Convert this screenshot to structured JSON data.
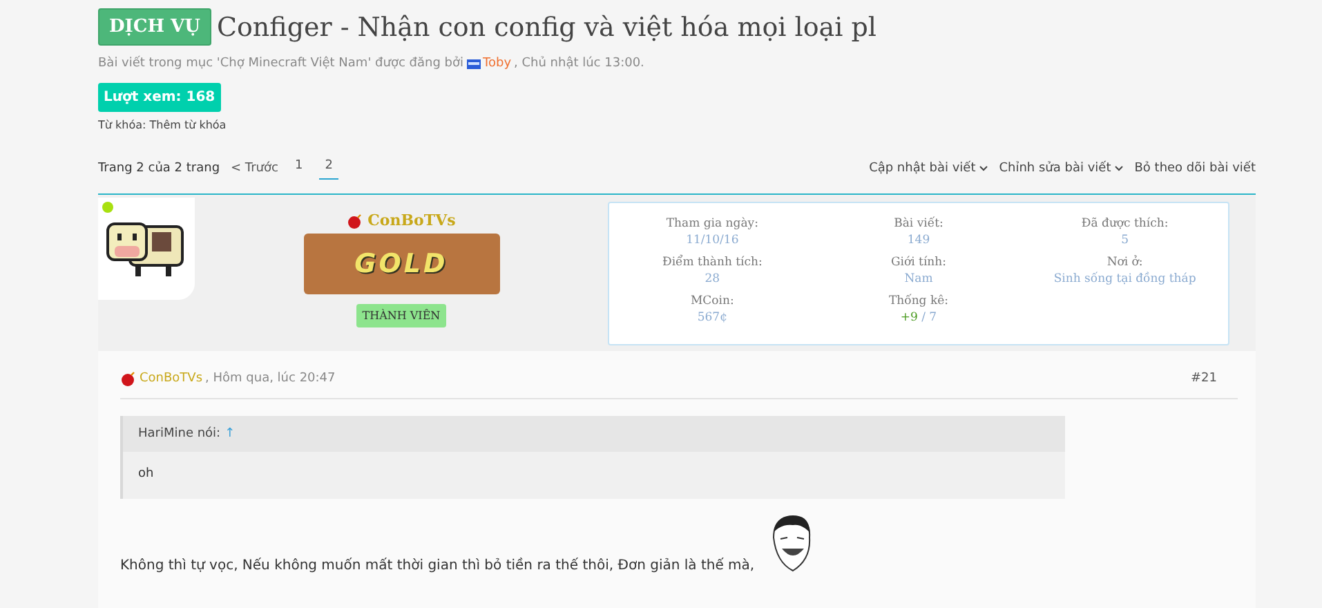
{
  "thread": {
    "prefix": "DỊCH VỤ",
    "title": "Configer - Nhận con config và việt hóa mọi loại pl"
  },
  "meta": {
    "before": "Bài viết trong mục 'Chợ Minecraft Việt Nam' được đăng bởi",
    "author": "Toby",
    "after": ", Chủ nhật lúc 13:00."
  },
  "views": "Lượt xem: 168",
  "tags": "Từ khóa: Thêm từ khóa",
  "pagination": {
    "label": "Trang 2 của 2 trang",
    "prev": "< Trước",
    "pages": [
      {
        "label": "1",
        "selected": false
      },
      {
        "label": "2",
        "selected": true
      }
    ]
  },
  "actions": [
    {
      "label": "Cập nhật bài viết",
      "dropdown": true
    },
    {
      "label": "Chỉnh sửa bài viết",
      "dropdown": true
    },
    {
      "label": "Bỏ theo dõi bài viết",
      "dropdown": false
    }
  ],
  "user": {
    "online": true,
    "name": "ConBoTVs",
    "banner": "GOLD",
    "role": "THÀNH VIÊN"
  },
  "stats": [
    {
      "label": "Tham gia ngày:",
      "value": "11/10/16"
    },
    {
      "label": "Bài viết:",
      "value": "149"
    },
    {
      "label": "Đã được thích:",
      "value": "5"
    },
    {
      "label": "Điểm thành tích:",
      "value": "28"
    },
    {
      "label": "Giới tính:",
      "value": "Nam"
    },
    {
      "label": "Nơi ở:",
      "value": "Sinh sống tại đồng tháp"
    },
    {
      "label": "MCoin:",
      "value": "567¢"
    },
    {
      "label": "Thống kê:",
      "positive": "+9",
      "value": "/ 7"
    }
  ],
  "post": {
    "author": "ConBoTVs",
    "time": ", Hôm qua, lúc 20:47",
    "number": "#21",
    "quote": {
      "attribution": "HariMine nói:",
      "arrow": "↑",
      "text": "oh"
    },
    "body": "Không thì tự vọc, Nếu không muốn mất thời gian thì bỏ tiền ra thế thôi, Đơn giản là thế mà,"
  }
}
